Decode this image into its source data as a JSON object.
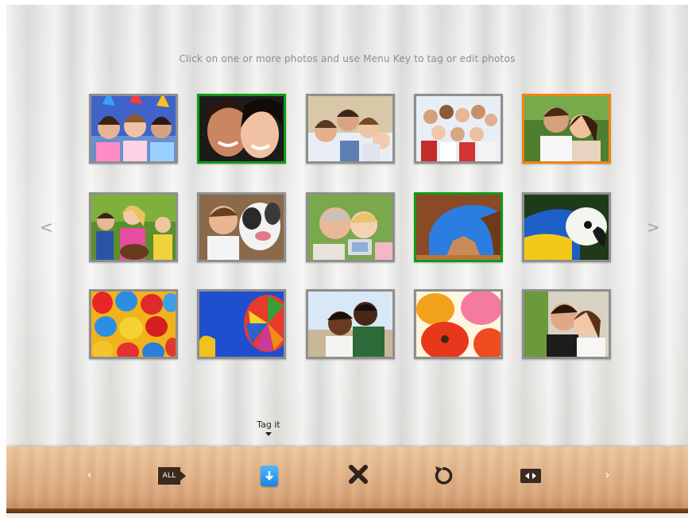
{
  "instruction": "Click on one or more photos and use Menu Key to tag or edit photos",
  "nav": {
    "prev_glyph": "<",
    "next_glyph": ">"
  },
  "photos": [
    {
      "subject": "kids in party hats",
      "state": "normal"
    },
    {
      "subject": "couple smiling close-up",
      "state": "selected-green"
    },
    {
      "subject": "family of four",
      "state": "normal"
    },
    {
      "subject": "group of friends",
      "state": "normal"
    },
    {
      "subject": "smiling couple",
      "state": "selected-orange"
    },
    {
      "subject": "children with dog",
      "state": "normal"
    },
    {
      "subject": "boy with dog",
      "state": "normal"
    },
    {
      "subject": "woman and girl with camera",
      "state": "normal"
    },
    {
      "subject": "rock arch",
      "state": "selected-green"
    },
    {
      "subject": "macaw parrot",
      "state": "normal"
    },
    {
      "subject": "colorful eggs",
      "state": "normal"
    },
    {
      "subject": "hot air balloon",
      "state": "normal"
    },
    {
      "subject": "couple on beach",
      "state": "normal"
    },
    {
      "subject": "poppy flowers",
      "state": "normal"
    },
    {
      "subject": "couple embracing",
      "state": "normal"
    }
  ],
  "tooltip": {
    "label": "Tag it"
  },
  "toolbar": {
    "prev_glyph": "‹",
    "next_glyph": "›",
    "all_label": "ALL",
    "buttons": [
      "select-all-icon",
      "tag-icon",
      "delete-icon",
      "rotate-icon",
      "slideshow-icon"
    ]
  },
  "colors": {
    "selected_green": "#0f9a14",
    "selected_orange": "#ef8412",
    "frame_gray": "#8f8f8f"
  }
}
